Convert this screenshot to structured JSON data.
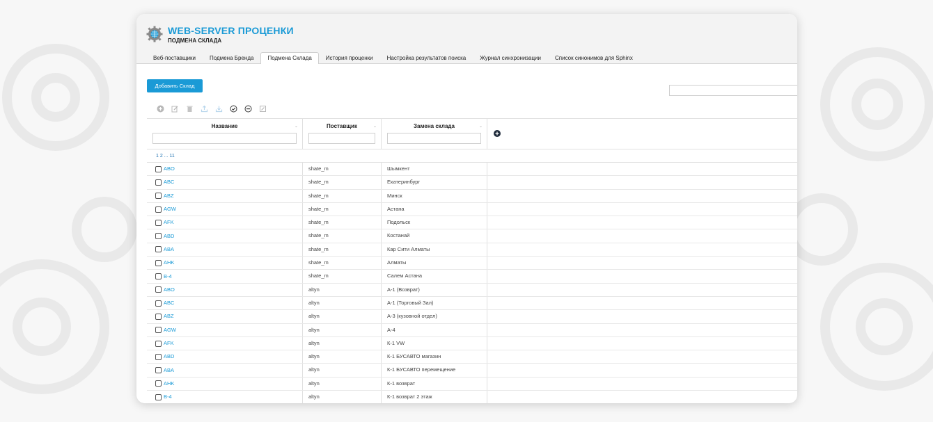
{
  "app": {
    "title": "WEB-SERVER ПРОЦЕНКИ",
    "subtitle": "ПОДМЕНА СКЛАДА"
  },
  "tabs": [
    {
      "label": "Веб-поставщики"
    },
    {
      "label": "Подмена Бренда"
    },
    {
      "label": "Подмена Склада",
      "active": true
    },
    {
      "label": "История проценки"
    },
    {
      "label": "Настройка результатов поиска"
    },
    {
      "label": "Журнал синхронизации"
    },
    {
      "label": "Список синонимов для Sphinx"
    }
  ],
  "toolbar": {
    "add_button": "Добавить Склад",
    "icons": [
      "add-icon",
      "edit-icon",
      "delete-icon",
      "export-icon",
      "import-icon",
      "check-all-icon",
      "uncheck-all-icon",
      "mass-edit-icon"
    ]
  },
  "grid": {
    "columns": [
      {
        "label": "Название"
      },
      {
        "label": "Поставщик"
      },
      {
        "label": "Замена склада"
      }
    ],
    "sort_glyph": "⌄",
    "pager": "1 2 ... 11",
    "rows": [
      {
        "code": "ABO",
        "supplier": "shate_m",
        "replacement": "Шымкент"
      },
      {
        "code": "ABC",
        "supplier": "shate_m",
        "replacement": "Екатеринбург"
      },
      {
        "code": "ABZ",
        "supplier": "shate_m",
        "replacement": "Минск"
      },
      {
        "code": "AGW",
        "supplier": "shate_m",
        "replacement": "Астана"
      },
      {
        "code": "AFK",
        "supplier": "shate_m",
        "replacement": "Подольск"
      },
      {
        "code": "ABD",
        "supplier": "shate_m",
        "replacement": "Костанай"
      },
      {
        "code": "ABA",
        "supplier": "shate_m",
        "replacement": "Кар Сити Алматы"
      },
      {
        "code": "AHK",
        "supplier": "shate_m",
        "replacement": "Алматы"
      },
      {
        "code": "B-4",
        "supplier": "shate_m",
        "replacement": "Салем Астана"
      },
      {
        "code": "ABO",
        "supplier": "altyn",
        "replacement": "А-1 (Возврат)"
      },
      {
        "code": "ABC",
        "supplier": "altyn",
        "replacement": "А-1 (Торговый Зал)"
      },
      {
        "code": "ABZ",
        "supplier": "altyn",
        "replacement": "А-3 (кузовной отдел)"
      },
      {
        "code": "AGW",
        "supplier": "altyn",
        "replacement": "А-4"
      },
      {
        "code": "AFK",
        "supplier": "altyn",
        "replacement": "К-1 VW"
      },
      {
        "code": "ABD",
        "supplier": "altyn",
        "replacement": "К-1 БУСАВТО магазин"
      },
      {
        "code": "ABA",
        "supplier": "altyn",
        "replacement": "К-1 БУСАВТО перемещение"
      },
      {
        "code": "AHK",
        "supplier": "altyn",
        "replacement": "К-1 возврат"
      },
      {
        "code": "B-4",
        "supplier": "altyn",
        "replacement": "К-1 возврат 2 этаж"
      }
    ]
  },
  "colors": {
    "accent": "#1a9ad6",
    "link": "#1a9ad6"
  }
}
